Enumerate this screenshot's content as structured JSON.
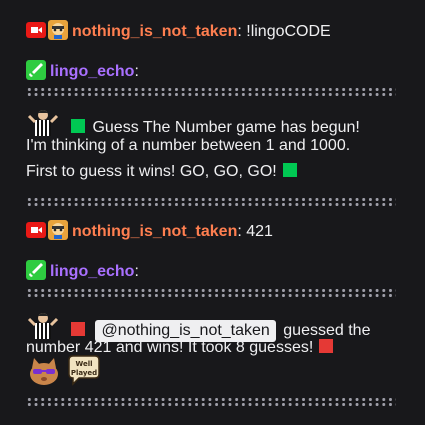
{
  "messages": [
    {
      "user": "nothing_is_not_taken",
      "user_color": "#ff7f50",
      "text": ": !lingoCODE"
    },
    {
      "user": "lingo_echo",
      "user_color": "#9147ff",
      "text": ":"
    },
    {
      "text_line1": "Guess The Number game has begun!",
      "text_line2": "I'm thinking of a number between 1 and 1000.",
      "text_line3": "First to guess it wins! GO, GO, GO!"
    },
    {
      "user": "nothing_is_not_taken",
      "user_color": "#ff7f50",
      "text": ": 421"
    },
    {
      "user": "lingo_echo",
      "user_color": "#9147ff",
      "text": ":"
    },
    {
      "mention": "@nothing_is_not_taken",
      "text_after": "guessed the",
      "text_line2": "number 421 and wins! It took 8 guesses!",
      "emote_text": "Well Played"
    }
  ],
  "colors": {
    "green_square": "#00c853",
    "red_square": "#e53935",
    "mod_green": "#2ecc40",
    "yt_red": "#e91916"
  },
  "icons": [
    "youtube-badge-icon",
    "avatar-badge-icon",
    "sword-mod-badge-icon",
    "referee-emote-icon",
    "cat-sunglasses-emote-icon",
    "well-played-emote-icon"
  ]
}
